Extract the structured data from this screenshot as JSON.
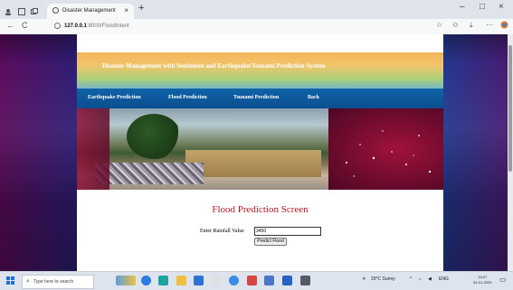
{
  "browser": {
    "tab_title": "Disaster Management",
    "tab_close": "×",
    "new_tab": "+",
    "url_host": "127.0.0.1",
    "url_path": ":8000/FloodIntent",
    "controls": {
      "minimize": "–",
      "maximize": "□",
      "close": "×"
    },
    "nav": {
      "back": "←",
      "reload": "C"
    }
  },
  "site": {
    "title": "Disaster Management with Sentiment and Earthquake/Tsunami Prediction System",
    "nav_items": [
      "Earthquake Prediction",
      "Flood Prediction",
      "Tsunami Prediction",
      "Back"
    ]
  },
  "page": {
    "heading": "Flood Prediction Screen",
    "rainfall_label": "Enter Rainfall Value",
    "rainfall_value": "3450",
    "predict_button": "Predict Flood"
  },
  "taskbar": {
    "search_placeholder": "Type here to search",
    "weather": "29°C Sunny",
    "language": "ENG",
    "time": "15:27",
    "date": "04-01-2025"
  },
  "colors": {
    "heading": "#c4161c",
    "navbar": "#0f62a8",
    "header_band": "#f4c46a"
  }
}
